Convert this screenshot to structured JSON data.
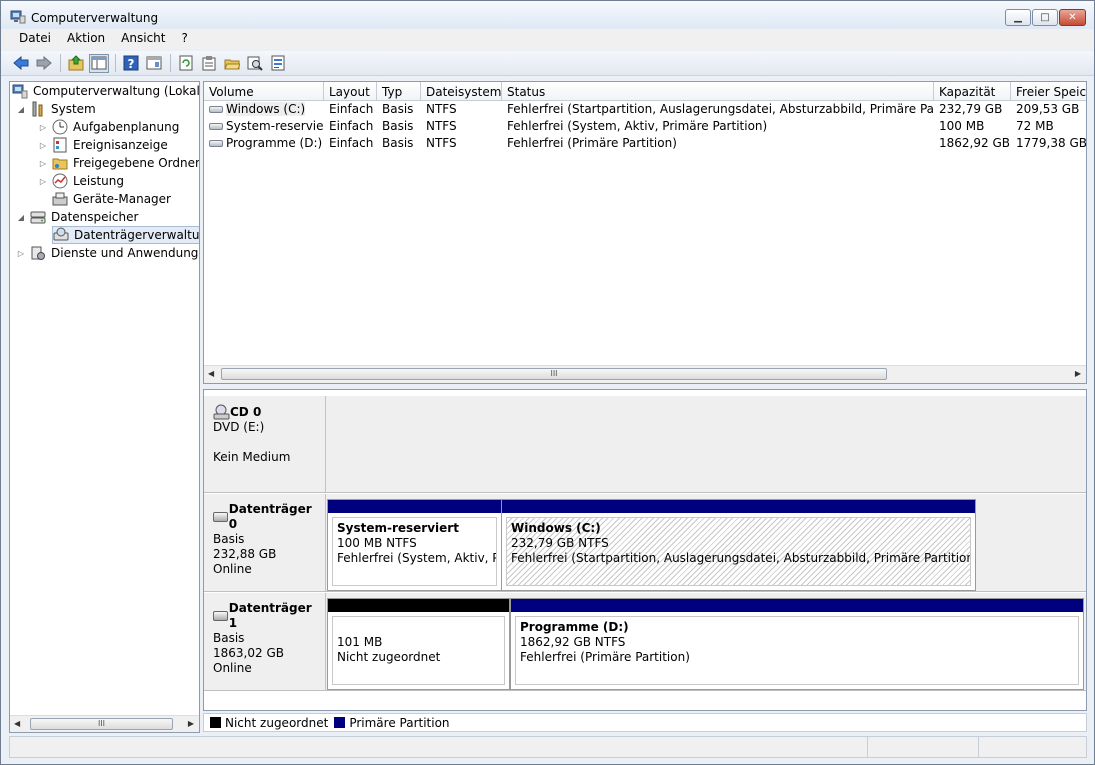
{
  "window": {
    "title": "Computerverwaltung",
    "btn_min": "▁",
    "btn_max": "□",
    "btn_close": "✕"
  },
  "menu": [
    "Datei",
    "Aktion",
    "Ansicht",
    "?"
  ],
  "toolbar": [
    "back-icon",
    "forward-icon",
    "up-folder-icon",
    "show-hide-tree-icon",
    "help-icon",
    "console-icon",
    "refresh-icon",
    "properties-icon",
    "open-icon",
    "search-icon",
    "export-icon"
  ],
  "tree": {
    "root": "Computerverwaltung (Lokal)",
    "system": "System",
    "aufgaben": "Aufgabenplanung",
    "ereignis": "Ereignisanzeige",
    "freigabe": "Freigegebene Ordner",
    "leistung": "Leistung",
    "geraete": "Geräte-Manager",
    "datenspeicher": "Datenspeicher",
    "datentraeger": "Datenträgerverwaltung",
    "dienste": "Dienste und Anwendungen"
  },
  "volume_table": {
    "columns": [
      "Volume",
      "Layout",
      "Typ",
      "Dateisystem",
      "Status",
      "Kapazität",
      "Freier Speich"
    ],
    "rows": [
      [
        "Windows (C:)",
        "Einfach",
        "Basis",
        "NTFS",
        "Fehlerfrei (Startpartition, Auslagerungsdatei, Absturzabbild, Primäre Partition)",
        "232,79 GB",
        "209,53 GB"
      ],
      [
        "System-reserviert",
        "Einfach",
        "Basis",
        "NTFS",
        "Fehlerfrei (System, Aktiv, Primäre Partition)",
        "100 MB",
        "72 MB"
      ],
      [
        "Programme (D:)",
        "Einfach",
        "Basis",
        "NTFS",
        "Fehlerfrei (Primäre Partition)",
        "1862,92 GB",
        "1779,38 GB"
      ]
    ]
  },
  "scroll_grip": "III",
  "disks": {
    "cd0": {
      "name": "CD 0",
      "line1": "DVD (E:)",
      "line2": "Kein Medium"
    },
    "disk0": {
      "name": "Datenträger 0",
      "type": "Basis",
      "size": "232,88 GB",
      "state": "Online",
      "p1": {
        "name": "System-reserviert",
        "size": "100 MB NTFS",
        "status": "Fehlerfrei (System, Aktiv, Primäre Partition)"
      },
      "p2": {
        "name": "Windows  (C:)",
        "size": "232,79 GB NTFS",
        "status": "Fehlerfrei (Startpartition, Auslagerungsdatei, Absturzabbild, Primäre Partition)"
      }
    },
    "disk1": {
      "name": "Datenträger 1",
      "type": "Basis",
      "size": "1863,02 GB",
      "state": "Online",
      "p1": {
        "size": "101 MB",
        "status": "Nicht zugeordnet"
      },
      "p2": {
        "name": "Programme  (D:)",
        "size": "1862,92 GB NTFS",
        "status": "Fehlerfrei (Primäre Partition)"
      }
    }
  },
  "legend": {
    "unallocated": "Nicht zugeordnet",
    "primary": "Primäre Partition"
  },
  "colors": {
    "primary": "#00007f",
    "unallocated": "#000000",
    "selection": "#e3ebf6"
  }
}
